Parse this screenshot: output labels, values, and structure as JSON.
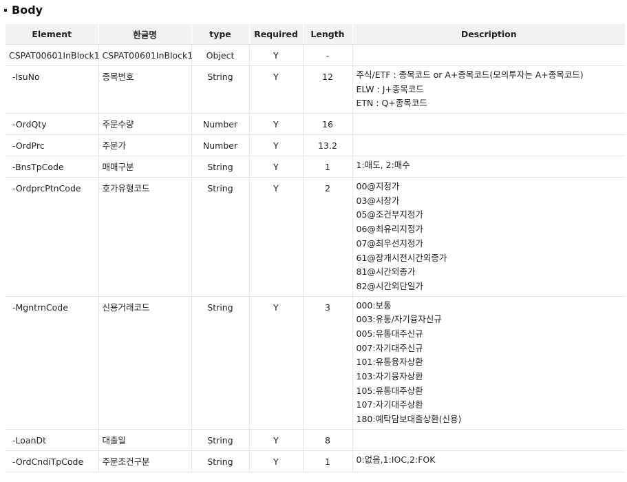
{
  "section": {
    "title": "Body"
  },
  "table": {
    "headers": [
      "Element",
      "한글명",
      "type",
      "Required",
      "Length",
      "Description"
    ],
    "rows": [
      {
        "element": "CSPAT00601InBlock1",
        "korean": "CSPAT00601InBlock1",
        "type": "Object",
        "required": "Y",
        "length": "-",
        "description": []
      },
      {
        "element": "-IsuNo",
        "korean": "종목번호",
        "type": "String",
        "required": "Y",
        "length": "12",
        "description": [
          "주식/ETF : 종목코드 or A+종목코드(모의투자는 A+종목코드)",
          "ELW : J+종목코드",
          "ETN : Q+종목코드"
        ]
      },
      {
        "element": "-OrdQty",
        "korean": "주문수량",
        "type": "Number",
        "required": "Y",
        "length": "16",
        "description": []
      },
      {
        "element": "-OrdPrc",
        "korean": "주문가",
        "type": "Number",
        "required": "Y",
        "length": "13.2",
        "description": []
      },
      {
        "element": "-BnsTpCode",
        "korean": "매매구분",
        "type": "String",
        "required": "Y",
        "length": "1",
        "description": [
          "1:매도, 2:매수"
        ]
      },
      {
        "element": "-OrdprcPtnCode",
        "korean": "호가유형코드",
        "type": "String",
        "required": "Y",
        "length": "2",
        "description": [
          "00@지정가",
          "03@시장가",
          "05@조건부지정가",
          "06@최유리지정가",
          "07@최우선지정가",
          "61@장개시전시간외종가",
          "81@시간외종가",
          "82@시간외단일가"
        ]
      },
      {
        "element": "-MgntrnCode",
        "korean": "신용거래코드",
        "type": "String",
        "required": "Y",
        "length": "3",
        "description": [
          "000:보통",
          "003:유통/자기융자신규",
          "005:유통대주신규",
          "007:자기대주신규",
          "101:유통융자상환",
          "103:자기융자상환",
          "105:유통대주상환",
          "107:자기대주상환",
          "180:예탁담보대출상환(신용)"
        ]
      },
      {
        "element": "-LoanDt",
        "korean": "대출일",
        "type": "String",
        "required": "Y",
        "length": "8",
        "description": []
      },
      {
        "element": "-OrdCndiTpCode",
        "korean": "주문조건구분",
        "type": "String",
        "required": "Y",
        "length": "1",
        "description": [
          "0:없음,1:IOC,2:FOK"
        ]
      }
    ]
  }
}
